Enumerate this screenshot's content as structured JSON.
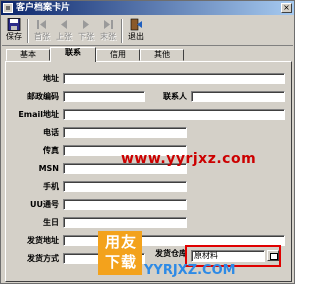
{
  "window": {
    "title": "客户档案卡片",
    "close_glyph": "×"
  },
  "toolbar": {
    "buttons": [
      {
        "label": "保存",
        "icon": "save-icon",
        "enabled": true
      },
      {
        "label": "首张",
        "icon": "first-record-icon",
        "enabled": false
      },
      {
        "label": "上张",
        "icon": "previous-record-icon",
        "enabled": false
      },
      {
        "label": "下张",
        "icon": "next-record-icon",
        "enabled": false
      },
      {
        "label": "末张",
        "icon": "last-record-icon",
        "enabled": false
      },
      {
        "label": "退出",
        "icon": "exit-icon",
        "enabled": true
      }
    ]
  },
  "tabs": [
    {
      "label": "基本",
      "active": false
    },
    {
      "label": "联系",
      "active": true
    },
    {
      "label": "信用",
      "active": false
    },
    {
      "label": "其他",
      "active": false
    }
  ],
  "form": {
    "address_label": "地址",
    "postcode_label": "邮政编码",
    "contact_label": "联系人",
    "email_label": "Email地址",
    "phone_label": "电话",
    "fax_label": "传真",
    "msn_label": "MSN",
    "mobile_label": "手机",
    "uu_label": "UU通号",
    "birthday_label": "生日",
    "ship_address_label": "发货地址",
    "ship_method_label": "发货方式",
    "ship_warehouse_label": "发货仓库",
    "ship_warehouse_value": "原材料"
  },
  "watermark": {
    "url": "www.yyrjxz.com",
    "logo_text_line1": "用友",
    "logo_text_line2": "下载",
    "bottom_url": "YYRJXZ.COM",
    "url_color": "#cc0000",
    "logo_color": "#f3a21c",
    "bottom_url_color": "#2d8ae6",
    "highlight_color": "#e00000"
  },
  "colors": {
    "title_bar_start": "#0a246a",
    "title_bar_end": "#a6caf0",
    "window_face": "#d4d0c8"
  }
}
